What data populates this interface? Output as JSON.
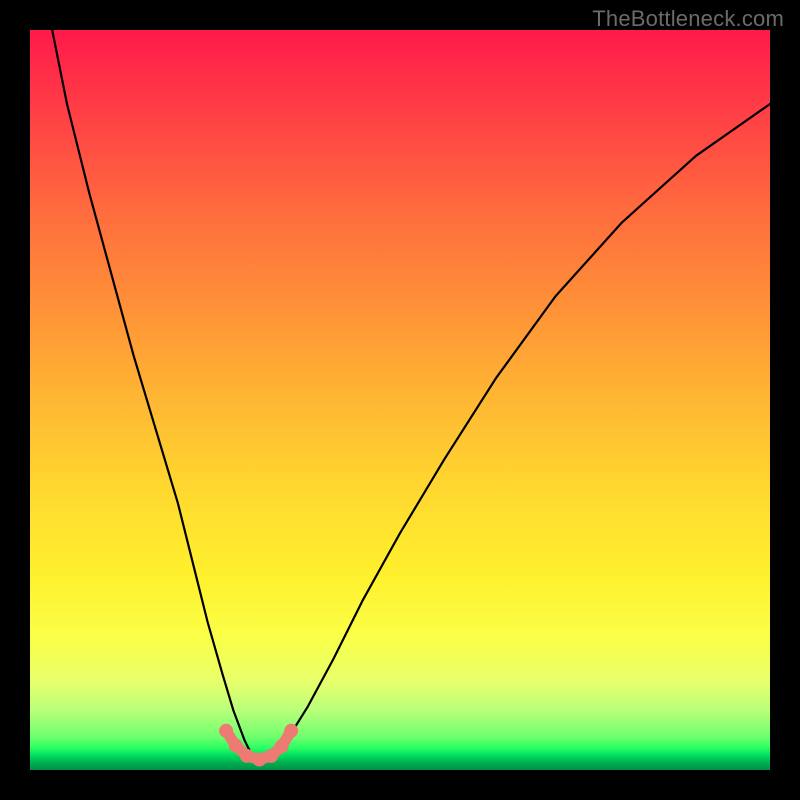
{
  "watermark": "TheBottleneck.com",
  "colors": {
    "marker": "#ed7b74",
    "curve": "#000000"
  },
  "chart_data": {
    "type": "line",
    "title": "",
    "xlabel": "",
    "ylabel": "",
    "xlim": [
      0,
      100
    ],
    "ylim": [
      0,
      100
    ],
    "grid": false,
    "legend": false,
    "series": [
      {
        "name": "bottleneck-curve",
        "x": [
          3,
          5,
          8,
          11,
          14,
          17,
          20,
          22,
          24,
          26,
          27.5,
          29,
          30,
          31.5,
          33,
          35,
          37.5,
          41,
          45,
          50,
          56,
          63,
          71,
          80,
          90,
          100
        ],
        "y": [
          100,
          90,
          78,
          67,
          56,
          46,
          36,
          28,
          20,
          13,
          8,
          4,
          2,
          1.2,
          2,
          4.5,
          8.5,
          15,
          23,
          32,
          42,
          53,
          64,
          74,
          83,
          90
        ]
      }
    ],
    "markers": {
      "name": "sweet-spot",
      "points": [
        {
          "x": 26.5,
          "y": 5.3
        },
        {
          "x": 27.8,
          "y": 3.3
        },
        {
          "x": 29.3,
          "y": 1.9
        },
        {
          "x": 31.0,
          "y": 1.4
        },
        {
          "x": 32.6,
          "y": 1.9
        },
        {
          "x": 34.0,
          "y": 3.2
        },
        {
          "x": 35.3,
          "y": 5.3
        }
      ],
      "radius_px": 7
    },
    "background_gradient": {
      "top": "#ff1a4a",
      "upper_mid": "#ffb733",
      "lower_mid": "#fff12e",
      "bottom": "#009048"
    }
  }
}
